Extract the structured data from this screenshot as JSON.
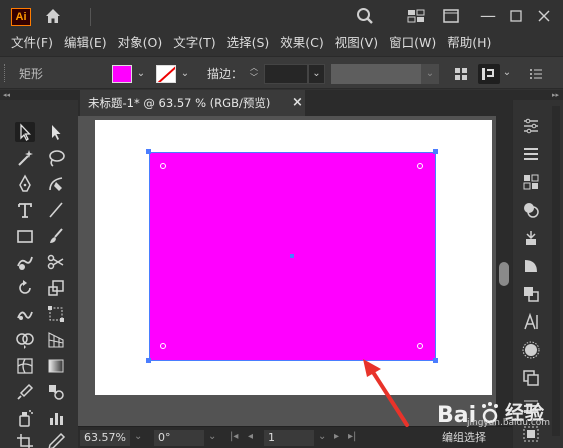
{
  "app": {
    "logo_text": "Ai"
  },
  "menu": [
    "文件(F)",
    "编辑(E)",
    "对象(O)",
    "文字(T)",
    "选择(S)",
    "效果(C)",
    "视图(V)",
    "窗口(W)",
    "帮助(H)"
  ],
  "control_bar": {
    "object_type": "矩形",
    "fill_color": "#ff00ff",
    "stroke_label": "描边：",
    "stroke_value": ""
  },
  "document": {
    "tab_title": "未标题-1* @ 63.57 % (RGB/预览)",
    "close_glyph": "×"
  },
  "canvas": {
    "artboard_color": "#ffffff",
    "rect_fill": "#ff00ff",
    "selection_color": "#4a7dff"
  },
  "status": {
    "zoom": "63.57%",
    "rotation": "0°",
    "artboard_number": "1",
    "mode": "编组选择"
  },
  "watermark": {
    "brand": "Bai",
    "brand_tail": "经验",
    "domain": "jingyan.baidu.com"
  }
}
